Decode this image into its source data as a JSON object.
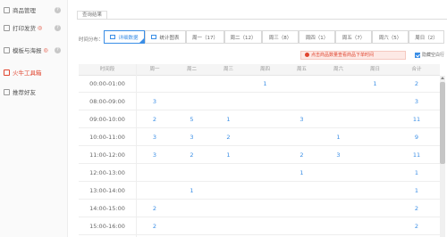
{
  "sidebar": {
    "items": [
      {
        "label": "商品管理",
        "icon": "box-icon",
        "info": "?"
      },
      {
        "label": "打印发货",
        "icon": "printer-icon",
        "badge": "◎",
        "info": "?"
      },
      {
        "label": "模板与海报",
        "icon": "template-icon",
        "badge": "◎",
        "info": "?"
      },
      {
        "label": "火牛工具箱",
        "icon": "toolbox-icon"
      },
      {
        "label": "推荐好友",
        "icon": "share-icon"
      }
    ]
  },
  "tabs": {
    "results": "查询结果"
  },
  "filter": {
    "label": "时间分布：",
    "buttons": [
      {
        "label": "详细数据",
        "icon": "table-icon"
      },
      {
        "label": "统计图表",
        "icon": "chart-icon"
      },
      {
        "label": "周一（17）"
      },
      {
        "label": "周二（12）"
      },
      {
        "label": "周三（8）"
      },
      {
        "label": "周四（1）"
      },
      {
        "label": "周五（7）"
      },
      {
        "label": "周六（5）"
      },
      {
        "label": "周日（2）"
      }
    ]
  },
  "notice": "点击商品数量查看商品下单时间",
  "hide_empty": "隐藏空白行",
  "table": {
    "headers": [
      "时间段",
      "周一",
      "周二",
      "周三",
      "周四",
      "周五",
      "周六",
      "周日",
      "合计"
    ],
    "rows": [
      [
        "00:00-01:00",
        "",
        "",
        "",
        "1",
        "",
        "",
        "1",
        "2"
      ],
      [
        "08:00-09:00",
        "3",
        "",
        "",
        "",
        "",
        "",
        "",
        "3"
      ],
      [
        "09:00-10:00",
        "2",
        "5",
        "1",
        "",
        "3",
        "",
        "",
        "11"
      ],
      [
        "10:00-11:00",
        "3",
        "3",
        "2",
        "",
        "",
        "1",
        "",
        "9"
      ],
      [
        "11:00-12:00",
        "3",
        "2",
        "1",
        "",
        "2",
        "3",
        "",
        "11"
      ],
      [
        "12:00-13:00",
        "",
        "",
        "",
        "",
        "1",
        "",
        "",
        "1"
      ],
      [
        "13:00-14:00",
        "",
        "1",
        "",
        "",
        "",
        "",
        "",
        "1"
      ],
      [
        "14:00-15:00",
        "2",
        "",
        "",
        "",
        "",
        "",
        "",
        "2"
      ],
      [
        "15:00-16:00",
        "2",
        "",
        "",
        "",
        "",
        "",
        "",
        "2"
      ]
    ]
  },
  "colors": {
    "accent": "#3a8ee6",
    "active": "#e0452f"
  }
}
